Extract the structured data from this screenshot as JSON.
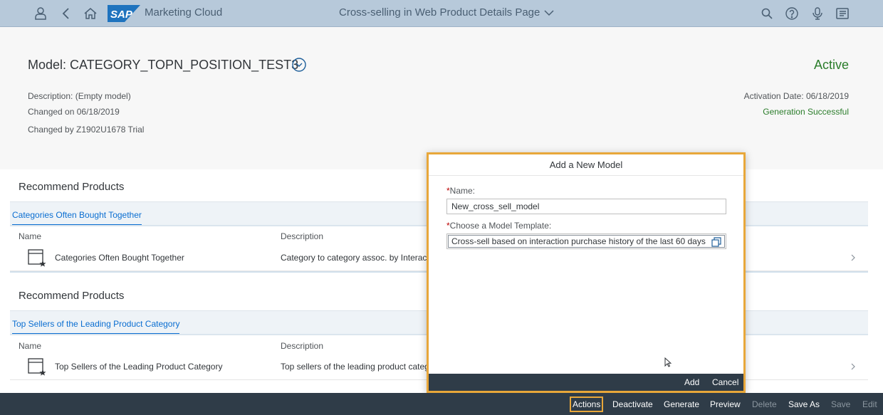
{
  "shell": {
    "app_name": "Marketing Cloud",
    "page_title": "Cross-selling in Web Product Details Page",
    "logo_text": "SAP"
  },
  "header": {
    "model_title": "Model: CATEGORY_TOPN_POSITION_TEST3",
    "status": "Active",
    "description": "Description: (Empty model)",
    "changed_on": "Changed on 06/18/2019",
    "changed_by": "Changed by Z1902U1678 Trial",
    "activation_date": "Activation Date: 06/18/2019",
    "generation_status": "Generation Successful"
  },
  "sections": [
    {
      "title": "Recommend Products",
      "tab": "Categories Often Bought Together",
      "col_name": "Name",
      "col_desc": "Description",
      "row_name": "Categories Often Bought Together",
      "row_desc": "Category to category assoc. by Interactio"
    },
    {
      "title": "Recommend Products",
      "tab": "Top Sellers of the Leading Product Category",
      "col_name": "Name",
      "col_desc": "Description",
      "row_name": "Top Sellers of the Leading Product Category",
      "row_desc": "Top sellers of the leading product catego"
    }
  ],
  "dialog": {
    "title": "Add a New Model",
    "name_label": "Name:",
    "name_value": "New_cross_sell_model",
    "template_label": "Choose a Model Template:",
    "template_value": "Cross-sell based on interaction purchase history of the last 60 days",
    "add_label": "Add",
    "cancel_label": "Cancel"
  },
  "footer": {
    "actions": "Actions",
    "deactivate": "Deactivate",
    "generate": "Generate",
    "preview": "Preview",
    "delete": "Delete",
    "save_as": "Save As",
    "save": "Save",
    "edit": "Edit"
  },
  "colors": {
    "shell_bg": "#b7c9da",
    "accent": "#0a6ed1",
    "status_green": "#2b7d2b",
    "highlight": "#e8a73a",
    "footer_bg": "#2f3c48"
  }
}
